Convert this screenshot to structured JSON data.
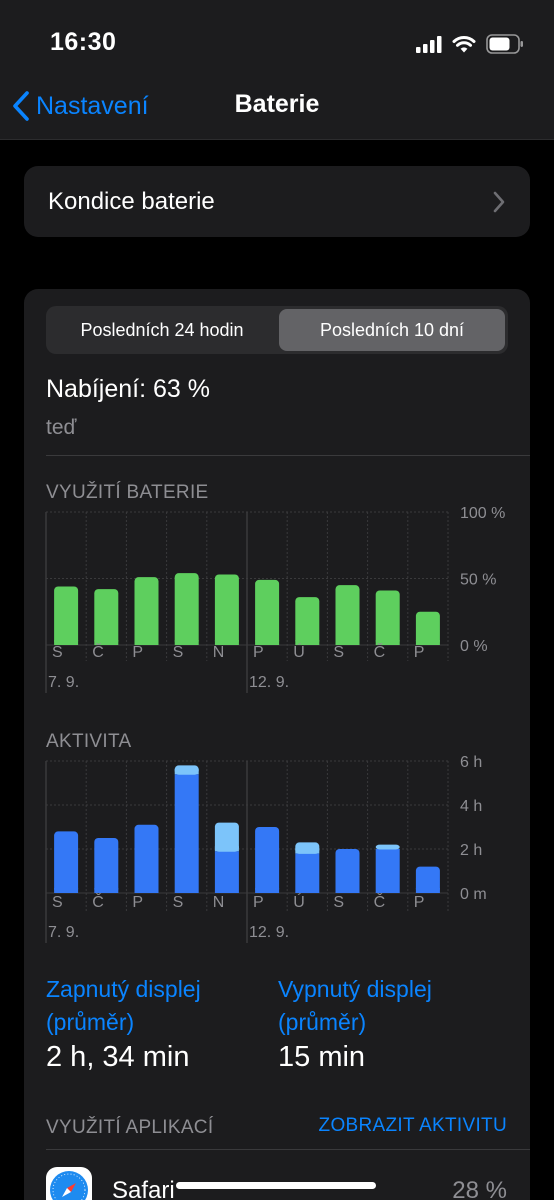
{
  "status_bar": {
    "time": "16:30"
  },
  "nav": {
    "back_label": "Nastavení",
    "title": "Baterie"
  },
  "battery_health": {
    "label": "Kondice baterie"
  },
  "segments": {
    "option_1": "Posledních 24 hodin",
    "option_2": "Posledních 10 dní",
    "selected": 1
  },
  "charging": {
    "title": "Nabíjení: 63 %",
    "subtitle": "teď"
  },
  "usage_chart": {
    "label": "VYUŽITÍ BATERIE",
    "y_ticks": [
      "100 %",
      "50 %",
      "0 %"
    ],
    "date_labels": [
      "7. 9.",
      "12. 9."
    ]
  },
  "activity_chart": {
    "label": "AKTIVITA",
    "y_ticks": [
      "6 h",
      "4 h",
      "2 h",
      "0 m"
    ],
    "date_labels": [
      "7. 9.",
      "12. 9."
    ]
  },
  "chart_data": [
    {
      "type": "bar",
      "title": "VYUŽITÍ BATERIE",
      "categories": [
        "S",
        "Č",
        "P",
        "S",
        "N",
        "P",
        "Ú",
        "S",
        "Č",
        "P"
      ],
      "values": [
        44,
        42,
        51,
        54,
        53,
        49,
        36,
        45,
        41,
        25
      ],
      "unit": "%",
      "ylim": [
        0,
        100
      ],
      "color": "#5ecf5e"
    },
    {
      "type": "bar",
      "title": "AKTIVITA",
      "categories": [
        "S",
        "Č",
        "P",
        "S",
        "N",
        "P",
        "Ú",
        "S",
        "Č",
        "P"
      ],
      "series": [
        {
          "values": [
            2.8,
            2.5,
            3.1,
            5.4,
            1.9,
            3.0,
            1.8,
            2.0,
            2.0,
            1.2
          ],
          "color": "#3478f6"
        },
        {
          "values": [
            0,
            0,
            0,
            0.4,
            1.3,
            0,
            0.5,
            0,
            0.2,
            0
          ],
          "color": "#7cc4fa"
        }
      ],
      "unit": "h",
      "ylim": [
        0,
        6
      ],
      "stacked": true
    }
  ],
  "stats": {
    "screen_on_label": "Zapnutý displej\n(průměr)",
    "screen_on_line1": "Zapnutý displej",
    "screen_on_line2": "(průměr)",
    "screen_on_value": "2 h, 34 min",
    "screen_off_line1": "Vypnutý displej",
    "screen_off_line2": "(průměr)",
    "screen_off_value": "15 min"
  },
  "app_usage": {
    "label": "VYUŽITÍ APLIKACÍ",
    "show_activity": "ZOBRAZIT AKTIVITU",
    "apps": [
      {
        "name": "Safari",
        "percent": "28 %",
        "icon": "safari-icon"
      }
    ]
  },
  "colors": {
    "accent": "#0a84ff",
    "battery_green": "#5ecf5e",
    "activity_blue": "#3478f6",
    "activity_light": "#7cc4fa"
  }
}
